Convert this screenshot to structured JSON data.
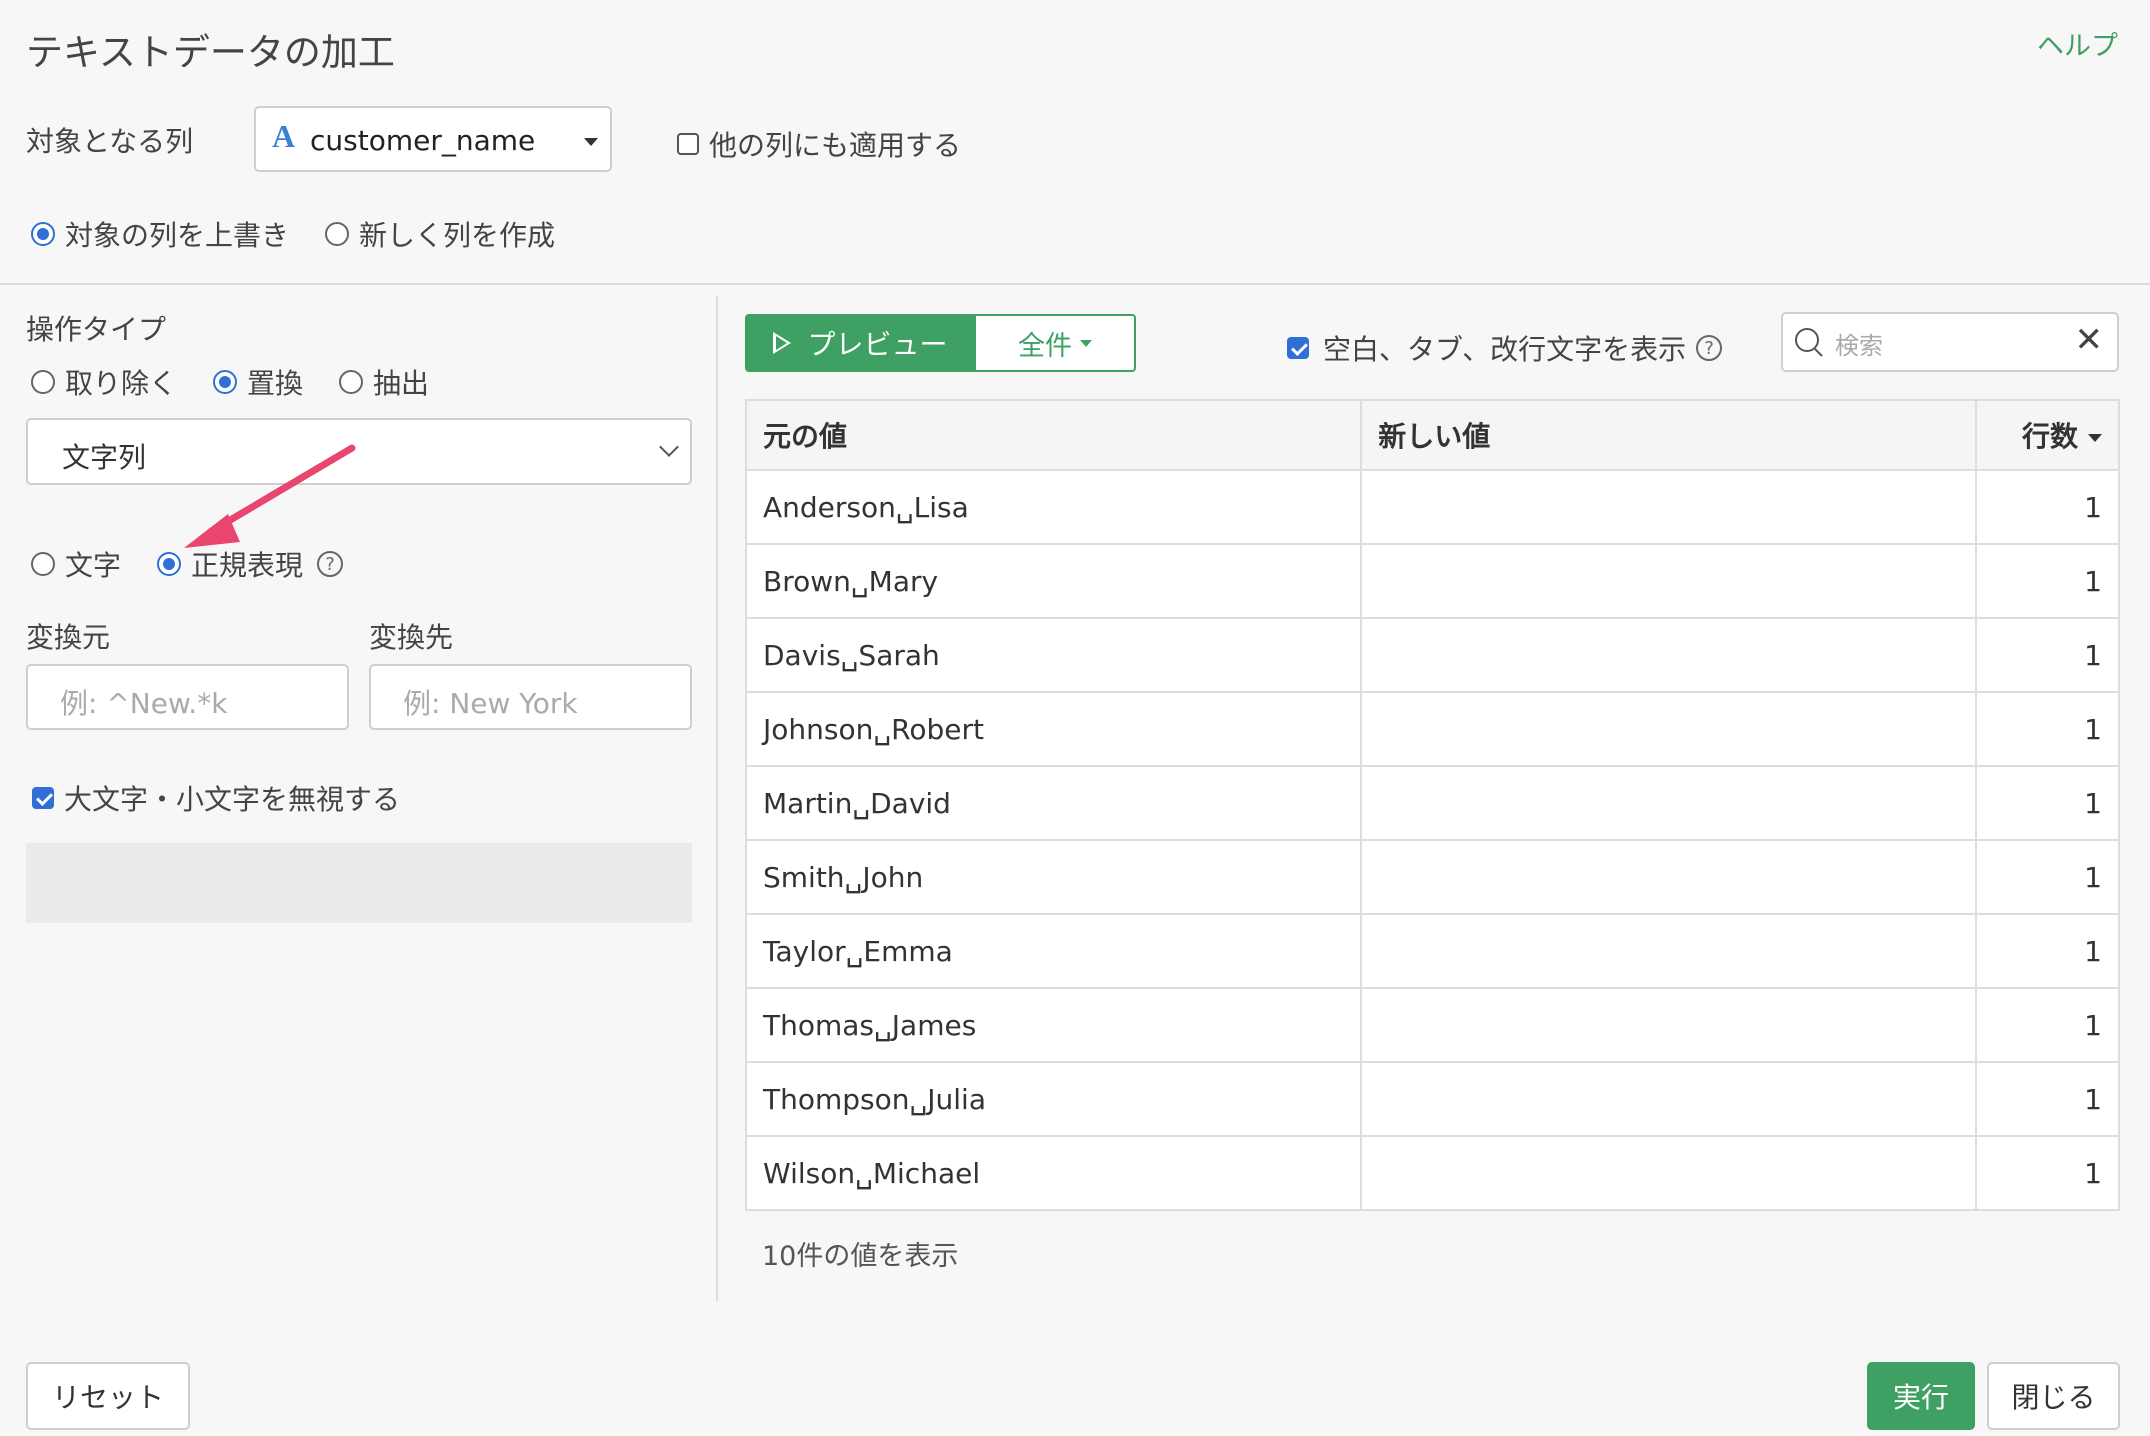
{
  "header": {
    "title": "テキストデータの加工",
    "help_label": "ヘルプ"
  },
  "target": {
    "label": "対象となる列",
    "column_icon": "A",
    "column_value": "customer_name",
    "apply_others_label": "他の列にも適用する",
    "apply_others_checked": false
  },
  "output_mode": {
    "options": [
      "対象の列を上書き",
      "新しく列を作成"
    ],
    "selected": 0
  },
  "operation": {
    "label": "操作タイプ",
    "options": [
      "取り除く",
      "置換",
      "抽出"
    ],
    "selected": 1,
    "subtype_value": "文字列",
    "match_options": [
      "文字",
      "正規表現"
    ],
    "match_selected": 1,
    "help_glyph": "?"
  },
  "replace": {
    "from_label": "変換元",
    "from_placeholder": "例: ^New.*k",
    "to_label": "変換先",
    "to_placeholder": "例: New York",
    "ignore_case_label": "大文字・小文字を無視する",
    "ignore_case_checked": true
  },
  "preview": {
    "preview_label": "プレビュー",
    "all_label": "全件",
    "show_whitespace_label": "空白、タブ、改行文字を表示",
    "show_whitespace_checked": true,
    "help_glyph": "?",
    "search_placeholder": "検索",
    "clear_glyph": "✕"
  },
  "table": {
    "headers": [
      "元の値",
      "新しい値",
      "行数"
    ],
    "rows": [
      {
        "orig": "Anderson␣Lisa",
        "new": "",
        "count": "1"
      },
      {
        "orig": "Brown␣Mary",
        "new": "",
        "count": "1"
      },
      {
        "orig": "Davis␣Sarah",
        "new": "",
        "count": "1"
      },
      {
        "orig": "Johnson␣Robert",
        "new": "",
        "count": "1"
      },
      {
        "orig": "Martin␣David",
        "new": "",
        "count": "1"
      },
      {
        "orig": "Smith␣John",
        "new": "",
        "count": "1"
      },
      {
        "orig": "Taylor␣Emma",
        "new": "",
        "count": "1"
      },
      {
        "orig": "Thomas␣James",
        "new": "",
        "count": "1"
      },
      {
        "orig": "Thompson␣Julia",
        "new": "",
        "count": "1"
      },
      {
        "orig": "Wilson␣Michael",
        "new": "",
        "count": "1"
      }
    ],
    "summary": "10件の値を表示"
  },
  "footer": {
    "reset_label": "リセット",
    "run_label": "実行",
    "close_label": "閉じる"
  },
  "colors": {
    "accent_green": "#3fa064",
    "radio_blue": "#2f6fd6",
    "arrow_pink": "#e8456f"
  }
}
